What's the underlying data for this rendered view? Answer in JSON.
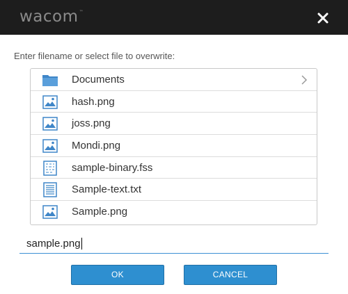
{
  "header": {
    "logo_text": "wacom",
    "logo_mark": "™",
    "close_icon": "close-icon"
  },
  "prompt_text": "Enter filename or select file to overwrite:",
  "files": [
    {
      "name": "Documents",
      "icon": "folder-icon",
      "has_chevron": true
    },
    {
      "name": "hash.png",
      "icon": "image-file-icon"
    },
    {
      "name": "joss.png",
      "icon": "image-file-icon"
    },
    {
      "name": "Mondi.png",
      "icon": "image-file-icon"
    },
    {
      "name": "sample-binary.fss",
      "icon": "binary-file-icon"
    },
    {
      "name": "Sample-text.txt",
      "icon": "text-file-icon"
    },
    {
      "name": "Sample.png",
      "icon": "image-file-icon"
    }
  ],
  "filename_input": {
    "value": "sample.png"
  },
  "buttons": {
    "ok": "OK",
    "cancel": "CANCEL"
  },
  "colors": {
    "titlebar": "#1d1d1d",
    "accent": "#2e8fd0",
    "icon_blue": "#3f86c8"
  }
}
